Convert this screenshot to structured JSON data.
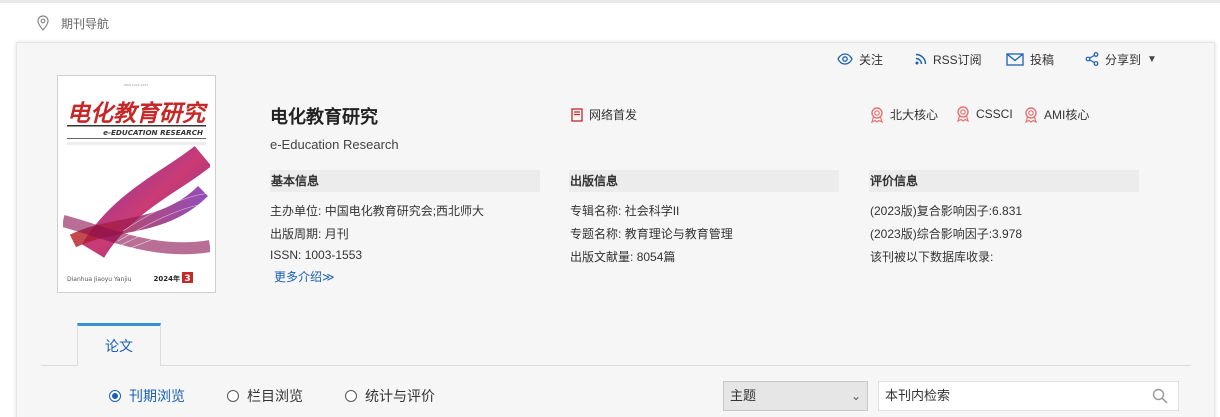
{
  "breadcrumb": {
    "label": "期刊导航",
    "icon": "location-pin-icon"
  },
  "toolbar": {
    "follow": "关注",
    "rss": "RSS订阅",
    "submit": "投稿",
    "share": "分享到",
    "accent": "#1a5fb4"
  },
  "journal": {
    "title": "电化教育研究",
    "subtitle": "e-Education Research",
    "network_first": "网络首发",
    "cover": {
      "cn_title": "电化教育研究",
      "en_title": "e-EDUCATION RESEARCH",
      "pinyin": "Dianhua Jiaoyu Yanjiu",
      "year_issue": "2024年",
      "issue_no": "3"
    }
  },
  "badges": [
    "北大核心",
    "CSSCI",
    "AMI核心"
  ],
  "basic": {
    "heading": "基本信息",
    "sponsor_key": "主办单位:",
    "sponsor_val": "中国电化教育研究会;西北师大",
    "period_key": "出版周期:",
    "period_val": "月刊",
    "issn_key": "ISSN:",
    "issn_val": "1003-1553",
    "more": "更多介绍≫"
  },
  "publish": {
    "heading": "出版信息",
    "series_key": "专辑名称:",
    "series_val": "社会科学II",
    "topic_key": "专题名称:",
    "topic_val": "教育理论与教育管理",
    "count_key": "出版文献量:",
    "count_val": "8054篇"
  },
  "evaluation": {
    "heading": "评价信息",
    "composite": "(2023版)复合影响因子:6.831",
    "comprehensive": "(2023版)综合影响因子:3.978",
    "db_label": "该刊被以下数据库收录:"
  },
  "tabs": [
    {
      "label": "论文",
      "active": true
    }
  ],
  "browse": {
    "options": [
      "刊期浏览",
      "栏目浏览",
      "统计与评价"
    ],
    "selected": 0
  },
  "search": {
    "field_selected": "主题",
    "placeholder": "本刊内检索"
  }
}
